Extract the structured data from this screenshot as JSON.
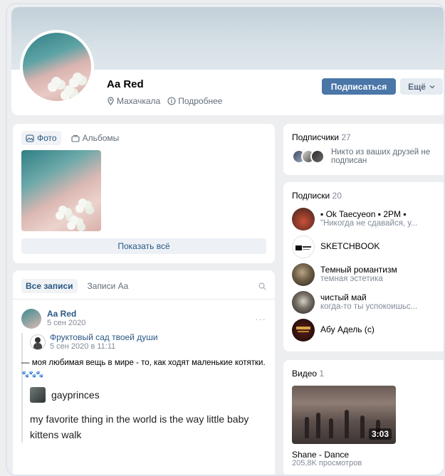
{
  "profile": {
    "name": "Aa Red",
    "city": "Махачкала",
    "details_label": "Подробнее",
    "subscribe_label": "Подписаться",
    "more_label": "Ещё"
  },
  "photos": {
    "tab_photos": "Фото",
    "tab_albums": "Альбомы",
    "show_all": "Показать всё"
  },
  "wall": {
    "tab_all": "Все записи",
    "tab_own": "Записи Aa",
    "post": {
      "author": "Aa Red",
      "date": "5 сен 2020",
      "repost": {
        "author": "Фруктовый сад твоей души",
        "date": "5 сен 2020 в 11:11",
        "text": "— моя любимая вещь в мире - то, как ходят маленькие котятки.",
        "paws": "🐾🐾🐾",
        "quote_name": "gayprinces",
        "quote_text": "my favorite thing in the world is the way little baby kittens walk"
      }
    }
  },
  "subscribers": {
    "title": "Подписчики",
    "count": "27",
    "note": "Никто из ваших друзей не подписан"
  },
  "subscriptions": {
    "title": "Подписки",
    "count": "20",
    "items": [
      {
        "name": "▪ Ok Taecyeon ▪ 2PM ▪",
        "desc": "\"Никогда не сдавайся, у..."
      },
      {
        "name": "SKETCHBOOK",
        "desc": ""
      },
      {
        "name": "Темный романтизм",
        "desc": "темная эстетика"
      },
      {
        "name": "чистый май",
        "desc": "когда-то ты успокоишьс..."
      },
      {
        "name": "Абу Адель (с)",
        "desc": ""
      }
    ]
  },
  "video": {
    "title": "Видео",
    "count": "1",
    "duration": "3:03",
    "name": "Shane - Dance",
    "views": "205,8K просмотров"
  },
  "colors": {
    "accent": "#4a76a8",
    "link": "#2a5885",
    "muted": "#828a99",
    "background": "#edeef0"
  }
}
